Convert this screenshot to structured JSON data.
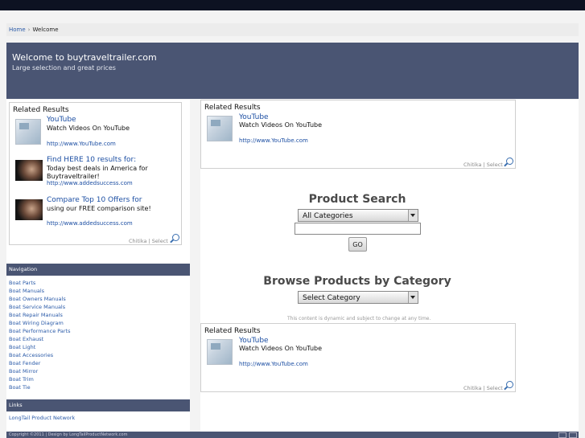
{
  "breadcrumb": {
    "home": "Home",
    "separator": "›",
    "current": "Welcome"
  },
  "banner": {
    "title": "Welcome to buytraveltrailer.com",
    "subtitle": "Large selection and great prices"
  },
  "related_label": "Related Results",
  "chitika_label": "Chitika | Select",
  "sidebar_ads": [
    {
      "title": "YouTube",
      "text": "Watch Videos On YouTube",
      "url": "http://www.YouTube.com",
      "thumb": "youtube-thumb"
    },
    {
      "title": "Find HERE 10 results for:",
      "text": "Today best deals in America for Buytraveltrailer!",
      "url": "http://www.addedsuccess.com",
      "thumb": "hand-thumb"
    },
    {
      "title": "Compare Top 10 Offers for",
      "text": "using our FREE comparison site!",
      "url": "http://www.addedsuccess.com",
      "thumb": "hand-thumb"
    }
  ],
  "main_ad": {
    "title": "YouTube",
    "text": "Watch Videos On YouTube",
    "url": "http://www.YouTube.com"
  },
  "product_search": {
    "title": "Product Search",
    "select_value": "All Categories",
    "input_value": "",
    "go_label": "GO"
  },
  "browse": {
    "title": "Browse Products by Category",
    "select_value": "Select Category",
    "note": "This content is dynamic and subject to change at any time."
  },
  "navigation": {
    "heading": "Navigation",
    "items": [
      "Boat Parts",
      "Boat Manuals",
      "Boat Owners Manuals",
      "Boat Service Manuals",
      "Boat Repair Manuals",
      "Boat Wiring Diagram",
      "Boat Performance Parts",
      "Boat Exhaust",
      "Boat Light",
      "Boat Accessories",
      "Boat Fender",
      "Boat Mirror",
      "Boat Trim",
      "Boat Tie"
    ]
  },
  "links": {
    "heading": "Links",
    "items": [
      "LongTail Product Network"
    ]
  },
  "footer": {
    "text": "Copyright ©2011 | Design by LongTailProductNetwork.com"
  },
  "colors": {
    "banner": "#4a5573",
    "link": "#2a5aa8",
    "topbar": "#0d1222"
  }
}
